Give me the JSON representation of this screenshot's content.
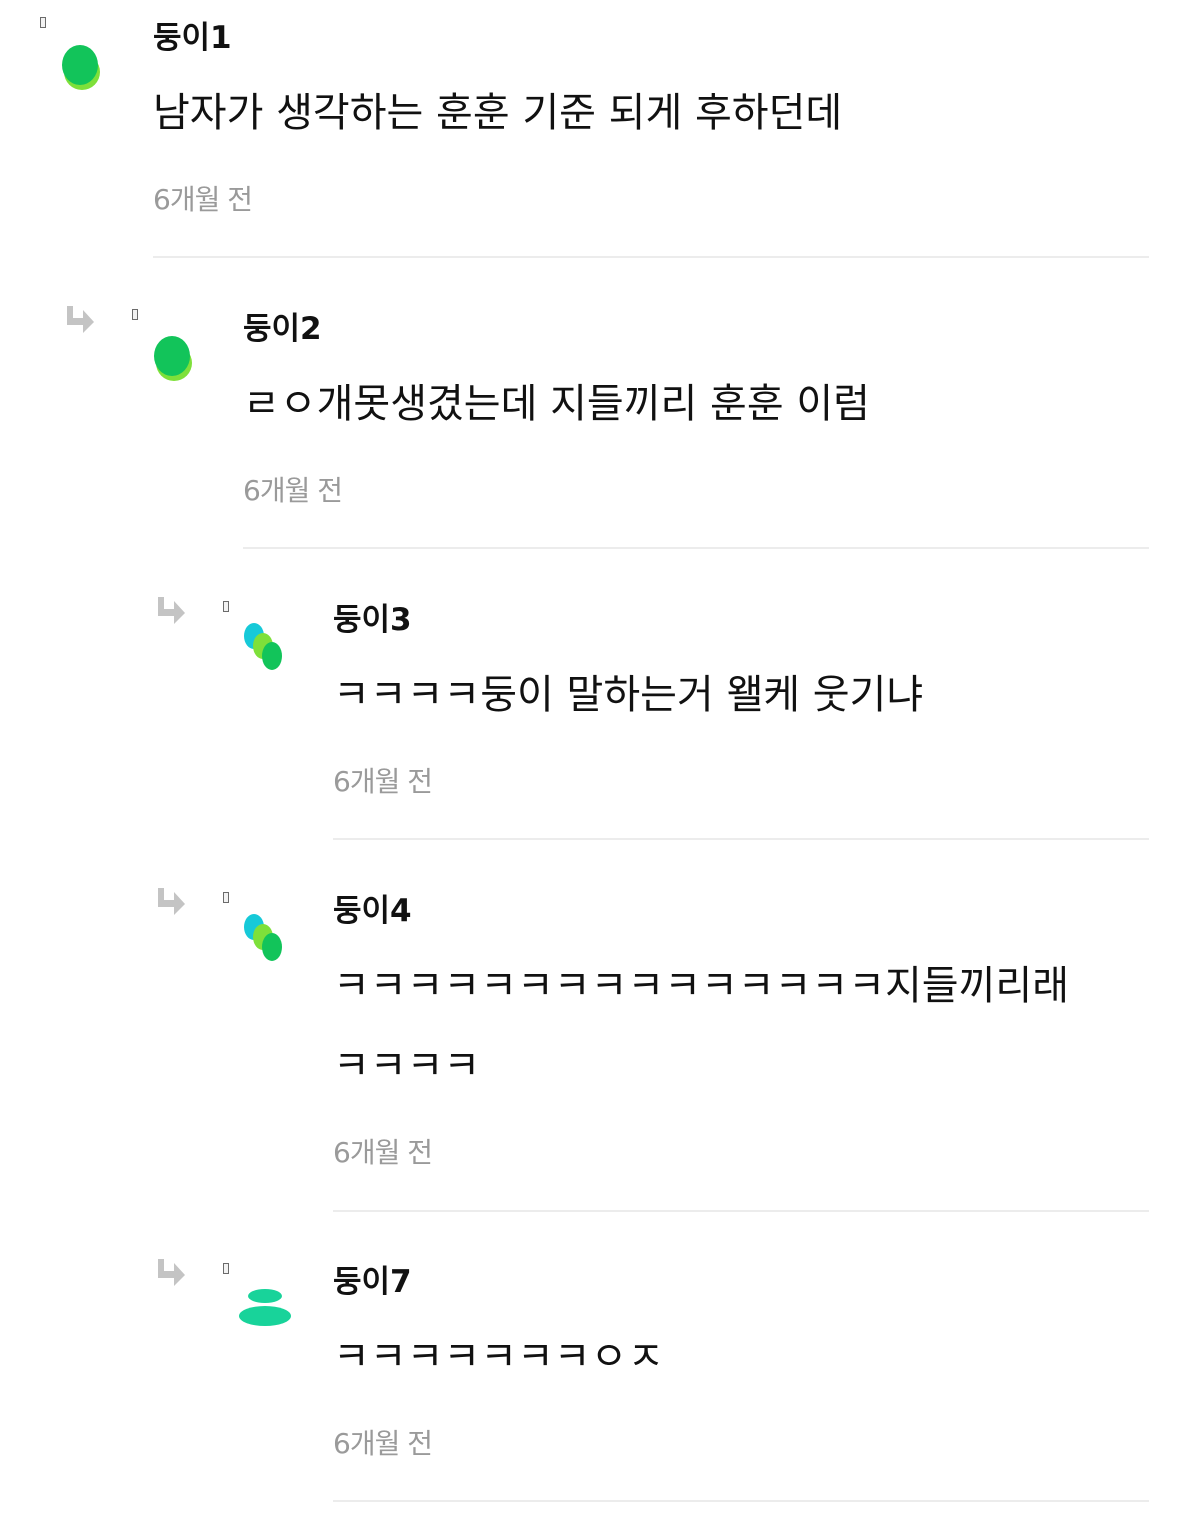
{
  "comments": [
    {
      "nickname": "둥이1",
      "lines": [
        "남자가 생각하는 훈훈 기준 되게 후하던데"
      ],
      "time": "6개월 전",
      "avatar": "green-blob-icon",
      "is_reply": false
    },
    {
      "nickname": "둥이2",
      "lines": [
        "ㄹㅇ개못생겼는데 지들끼리 훈훈 이럼"
      ],
      "time": "6개월 전",
      "avatar": "green-blob-icon",
      "is_reply": true
    },
    {
      "nickname": "둥이3",
      "lines": [
        "ㅋㅋㅋㅋ둥이 말하는거 왤케 웃기냐"
      ],
      "time": "6개월 전",
      "avatar": "triple-dot-icon",
      "is_reply": true
    },
    {
      "nickname": "둥이4",
      "lines": [
        "ㅋㅋㅋㅋㅋㅋㅋㅋㅋㅋㅋㅋㅋㅋㅋ지들끼리래",
        "ㅋㅋㅋㅋ"
      ],
      "time": "6개월 전",
      "avatar": "triple-dot-icon",
      "is_reply": true
    },
    {
      "nickname": "둥이7",
      "lines": [
        "ㅋㅋㅋㅋㅋㅋㅋㅇㅈ"
      ],
      "time": "6개월 전",
      "avatar": "mint-disc-icon",
      "is_reply": true
    }
  ],
  "colors": {
    "green": "#12c45a",
    "lime": "#7ee03a",
    "cyan": "#16c9d8",
    "mint": "#18d39a",
    "reply_arrow": "#c4c4c4",
    "divider": "#ececec",
    "timestamp": "#9a9a9a"
  }
}
